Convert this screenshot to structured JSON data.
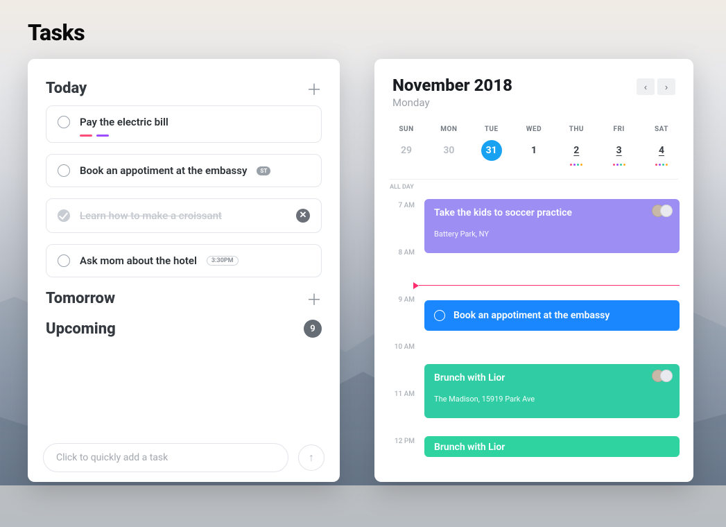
{
  "page_title": "Tasks",
  "tasks": {
    "sections": {
      "today": {
        "title": "Today",
        "items": [
          {
            "title": "Pay the electric bill",
            "tag_colors": [
              "#ff4d79",
              "#9d4dff"
            ]
          },
          {
            "title": "Book an appotiment at the embassy",
            "badge": "ST"
          },
          {
            "title": "Learn how to make a croissant",
            "completed": true
          },
          {
            "title": "Ask mom about the hotel",
            "time_pill": "3:30PM"
          }
        ]
      },
      "tomorrow": {
        "title": "Tomorrow"
      },
      "upcoming": {
        "title": "Upcoming",
        "count": "9"
      }
    },
    "quick_add_placeholder": "Click to quickly add a task"
  },
  "calendar": {
    "title": "November 2018",
    "subtitle": "Monday",
    "dow": [
      "SUN",
      "MON",
      "TUE",
      "WED",
      "THU",
      "FRI",
      "SAT"
    ],
    "days": [
      {
        "num": "29",
        "muted": true
      },
      {
        "num": "30",
        "muted": true
      },
      {
        "num": "31",
        "selected": true
      },
      {
        "num": "1"
      },
      {
        "num": "2",
        "underline": true,
        "dots": [
          "#ff4d79",
          "#9d4dff",
          "#30cda4",
          "#ffb020"
        ]
      },
      {
        "num": "3",
        "underline": true,
        "dots": [
          "#ff4d79",
          "#9d4dff",
          "#30cda4",
          "#ffb020"
        ]
      },
      {
        "num": "4",
        "underline": true,
        "dots": [
          "#ff4d79",
          "#9d4dff",
          "#30cda4",
          "#ffb020"
        ]
      }
    ],
    "allday_label": "ALL DAY",
    "hours": [
      "7 AM",
      "8 AM",
      "9 AM",
      "10 AM",
      "11 AM",
      "12 PM"
    ],
    "events": {
      "e1": {
        "title": "Take the kids to soccer practice",
        "location": "Battery Park, NY"
      },
      "e2": {
        "title": "Book an appotiment at the embassy"
      },
      "e3": {
        "title": "Brunch with Lior",
        "location": "The Madison, 15919 Park Ave"
      },
      "e4": {
        "title": "Brunch with Lior"
      }
    },
    "colors": {
      "purple": "#9c8ef2",
      "blue": "#1a87ff",
      "teal": "#30cda4",
      "accent_pink": "#ff2d6e"
    }
  }
}
